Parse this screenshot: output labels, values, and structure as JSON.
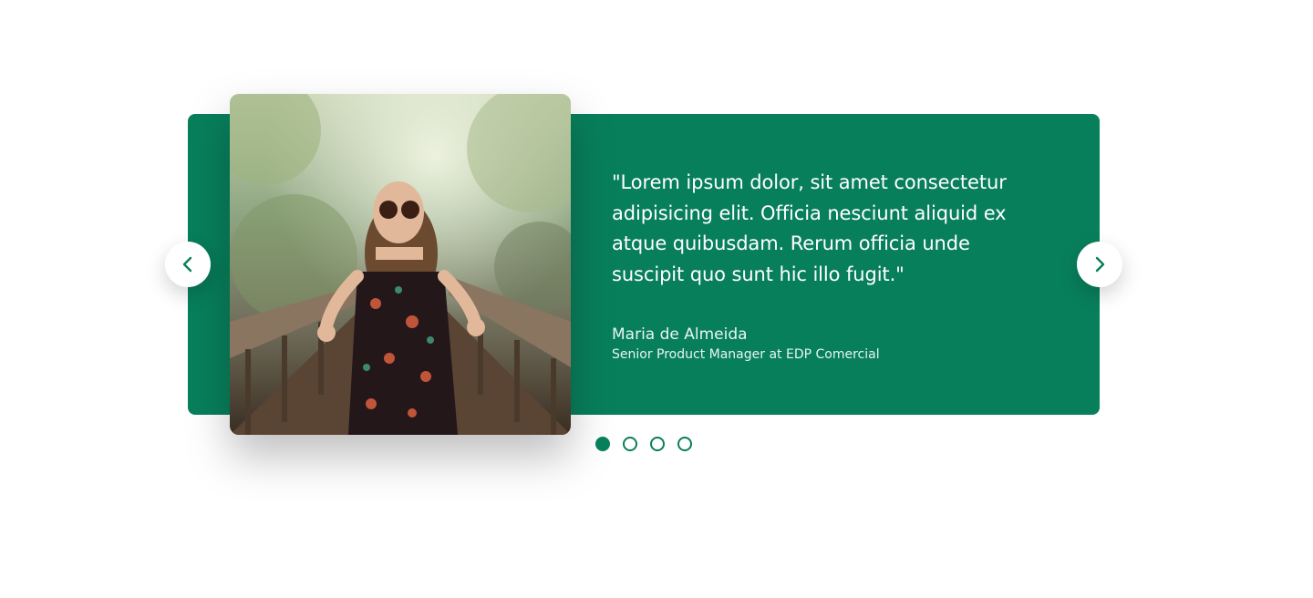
{
  "testimonial": {
    "quote": "\"Lorem ipsum dolor, sit amet consectetur adipisicing elit. Officia nesciunt aliquid ex atque quibusdam. Rerum officia unde suscipit quo sunt hic illo fugit.\"",
    "author": "Maria de Almeida",
    "role": "Senior Product Manager at EDP Comercial"
  },
  "carousel": {
    "slide_count": 4,
    "active_index": 0
  },
  "colors": {
    "accent": "#087f5b",
    "text_on_accent": "#ffffff"
  },
  "icons": {
    "prev": "chevron-left-icon",
    "next": "chevron-right-icon"
  }
}
